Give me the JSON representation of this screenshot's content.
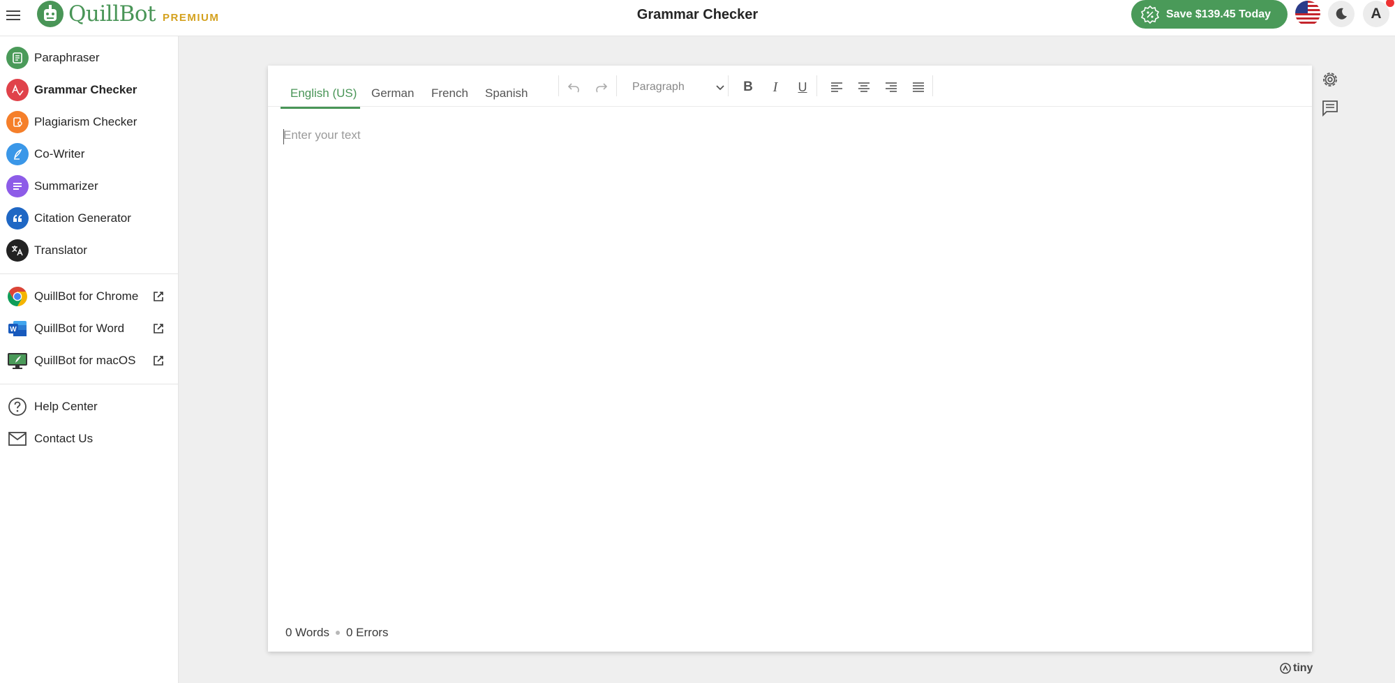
{
  "header": {
    "brand_name": "QuillBot",
    "brand_tier": "PREMIUM",
    "title": "Grammar Checker",
    "promo_label": "Save $139.45 Today",
    "avatar_initial": "A"
  },
  "sidebar": {
    "tools": [
      {
        "label": "Paraphraser",
        "icon": "paraphraser-icon",
        "color": "#4a9a59"
      },
      {
        "label": "Grammar Checker",
        "icon": "grammar-checker-icon",
        "color": "#e0424a",
        "active": true
      },
      {
        "label": "Plagiarism Checker",
        "icon": "plagiarism-checker-icon",
        "color": "#f57f2a"
      },
      {
        "label": "Co-Writer",
        "icon": "co-writer-icon",
        "color": "#3a97e8"
      },
      {
        "label": "Summarizer",
        "icon": "summarizer-icon",
        "color": "#8d5ce8"
      },
      {
        "label": "Citation Generator",
        "icon": "citation-generator-icon",
        "color": "#1f67c4"
      },
      {
        "label": "Translator",
        "icon": "translator-icon",
        "color": "#222222"
      }
    ],
    "extensions": [
      {
        "label": "QuillBot for Chrome",
        "icon": "chrome-icon"
      },
      {
        "label": "QuillBot for Word",
        "icon": "word-icon"
      },
      {
        "label": "QuillBot for macOS",
        "icon": "macos-icon"
      }
    ],
    "support": [
      {
        "label": "Help Center",
        "icon": "help-icon"
      },
      {
        "label": "Contact Us",
        "icon": "mail-icon"
      }
    ]
  },
  "editor": {
    "languages": [
      "English (US)",
      "German",
      "French",
      "Spanish"
    ],
    "active_language": "English (US)",
    "block_format": "Paragraph",
    "placeholder": "Enter your text",
    "word_count": "0 Words",
    "error_count": "0 Errors",
    "powered_by": "tiny"
  },
  "colors": {
    "brand_green": "#499557",
    "premium_gold": "#d4a11e"
  }
}
